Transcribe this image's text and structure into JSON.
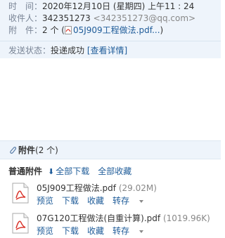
{
  "header": {
    "time_label": "时　间：",
    "time_value": "2020年12月10日 (星期四) 上午11 : 24",
    "recipient_label": "收件人：",
    "recipient_name": "342351273",
    "recipient_email": "<342351273@qq.com>",
    "attachment_label": "附　件：",
    "attachment_count": "2 个 (",
    "attachment_preview": "05J909工程做法.pdf...",
    "attachment_close": ")",
    "status_label": "发送状态：",
    "status_value": "投递成功",
    "status_link": "[查看详情]"
  },
  "attachments": {
    "title": "附件",
    "count": "(2 个)",
    "ordinary_label": "普通附件",
    "download_all": "全部下载",
    "collect_all": "全部收藏",
    "files": [
      {
        "name": "05J909工程做法.pdf",
        "size": "(29.02M)",
        "preview": "预览",
        "download": "下载",
        "collect": "收藏",
        "forward": "转存"
      },
      {
        "name": "07G120工程做法(自重计算).pdf",
        "size": "(1019.96K)",
        "preview": "预览",
        "download": "下载",
        "collect": "收藏",
        "forward": "转存"
      }
    ]
  },
  "colors": {
    "link": "#1f5c99",
    "header_bg": "#eef4fb",
    "pdf_red": "#d9342b"
  },
  "icons": {
    "file": "pdf-icon",
    "attachment": "paperclip-icon",
    "download": "download-arrow-icon",
    "dropdown": "chevron-down-icon"
  }
}
